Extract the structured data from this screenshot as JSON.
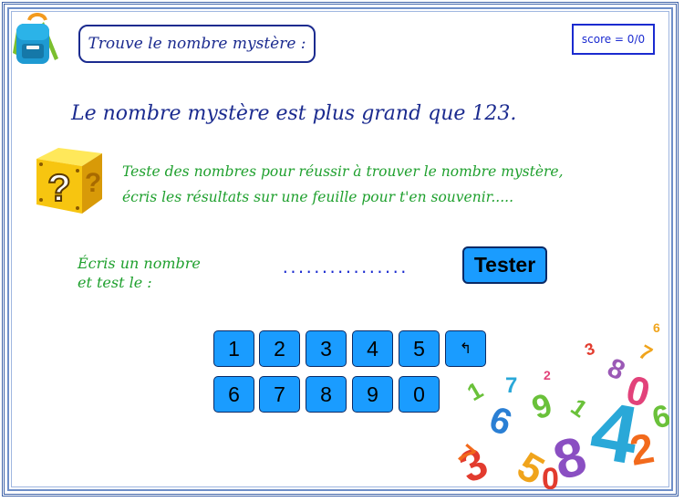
{
  "header": {
    "title": "Trouve le nombre mystère :",
    "score": "score = 0/0"
  },
  "clue": "Le nombre mystère est plus grand que 123.",
  "instructions": {
    "line1": "Teste des nombres pour réussir à trouver le nombre mystère,",
    "line2": "écris les résultats sur une feuille pour t'en souvenir....."
  },
  "prompt": {
    "line1": "Écris un nombre",
    "line2": "et test le :"
  },
  "answer": {
    "value": "................"
  },
  "tester_label": "Tester",
  "keypad": {
    "row1": [
      "1",
      "2",
      "3",
      "4",
      "5",
      "↰"
    ],
    "row2": [
      "6",
      "7",
      "8",
      "9",
      "0"
    ]
  },
  "colors": {
    "title": "#1b2b8f",
    "green_text": "#1fa02e",
    "button": "#1a9cff",
    "score": "#1b2bd0"
  },
  "icons": [
    "backpack-icon",
    "question-block-icon",
    "backspace-icon",
    "numbers-illustration"
  ]
}
